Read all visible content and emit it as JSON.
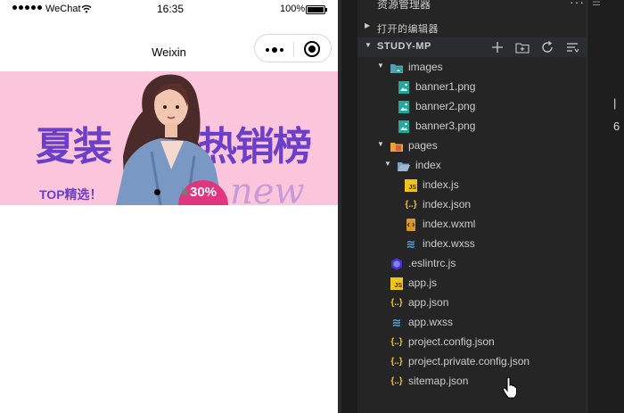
{
  "status_bar": {
    "carrier": "WeChat",
    "time": "16:35",
    "battery": "100%"
  },
  "nav": {
    "title": "Weixin"
  },
  "banner": {
    "left_text": "夏装",
    "right_text": "热销榜",
    "subtitle": "TOP精选！",
    "badge": "30%",
    "decor": "new",
    "dot_colors": [
      "#000000",
      "#7a7a7a"
    ]
  },
  "explorer": {
    "title": "资源管理器",
    "more": "···",
    "open_editors": "打开的编辑器",
    "project": "STUDY-MP",
    "tree": [
      {
        "label": "images",
        "kind": "folder-images",
        "depth": 1,
        "expanded": true
      },
      {
        "label": "banner1.png",
        "kind": "png",
        "depth": 2
      },
      {
        "label": "banner2.png",
        "kind": "png",
        "depth": 2
      },
      {
        "label": "banner3.png",
        "kind": "png",
        "depth": 2
      },
      {
        "label": "pages",
        "kind": "folder-pages",
        "depth": 1,
        "expanded": true
      },
      {
        "label": "index",
        "kind": "folder",
        "depth": 2,
        "expanded": true
      },
      {
        "label": "index.js",
        "kind": "js",
        "depth": 3
      },
      {
        "label": "index.json",
        "kind": "json",
        "depth": 3
      },
      {
        "label": "index.wxml",
        "kind": "wxml",
        "depth": 3
      },
      {
        "label": "index.wxss",
        "kind": "wxss",
        "depth": 3
      },
      {
        "label": ".eslintrc.js",
        "kind": "eslint",
        "depth": 1
      },
      {
        "label": "app.js",
        "kind": "js",
        "depth": 1
      },
      {
        "label": "app.json",
        "kind": "json",
        "depth": 1
      },
      {
        "label": "app.wxss",
        "kind": "wxss",
        "depth": 1
      },
      {
        "label": "project.config.json",
        "kind": "json",
        "depth": 1
      },
      {
        "label": "project.private.config.json",
        "kind": "json",
        "depth": 1
      },
      {
        "label": "sitemap.json",
        "kind": "json",
        "depth": 1
      }
    ]
  },
  "editor_strip": {
    "glyph": "6"
  },
  "colors": {
    "banner_bg": "#fbc6dc",
    "banner_text": "#6b3fc8",
    "explorer_bg": "#252526",
    "json_icon": "#f0c419",
    "wxss_icon": "#4fa3e0",
    "png_icon": "#26a69a"
  }
}
